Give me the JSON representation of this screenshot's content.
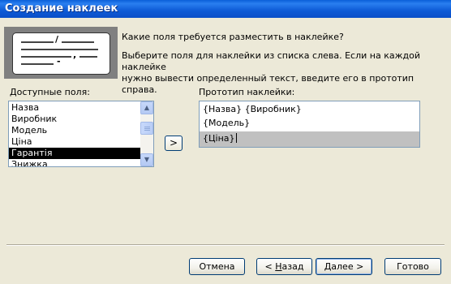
{
  "window": {
    "title": "Создание наклеек"
  },
  "preview": {
    "marks": [
      "/",
      ",",
      "-"
    ]
  },
  "text": {
    "question": "Какие поля требуется разместить в наклейке?",
    "instruction_1": "Выберите поля для наклейки из списка слева. Если на каждой наклейке",
    "instruction_2": "нужно вывести определенный текст, введите его в прототип справа."
  },
  "available": {
    "label": "Доступные поля:",
    "items": [
      "Назва",
      "Виробник",
      "Модель",
      "Ціна",
      "Гарантія",
      "Знижка"
    ],
    "selected": "Гарантія"
  },
  "add_button": {
    "label": ">"
  },
  "prototype": {
    "label": "Прототип наклейки:",
    "lines": [
      "{Назва} {Виробник}",
      "{Модель}",
      "{Ціна}"
    ]
  },
  "buttons": {
    "cancel": "Отмена",
    "back_prefix": "< ",
    "back_key": "Н",
    "back_rest": "азад",
    "next_key": "Д",
    "next_rest": "алее >",
    "finish": "Готово"
  }
}
